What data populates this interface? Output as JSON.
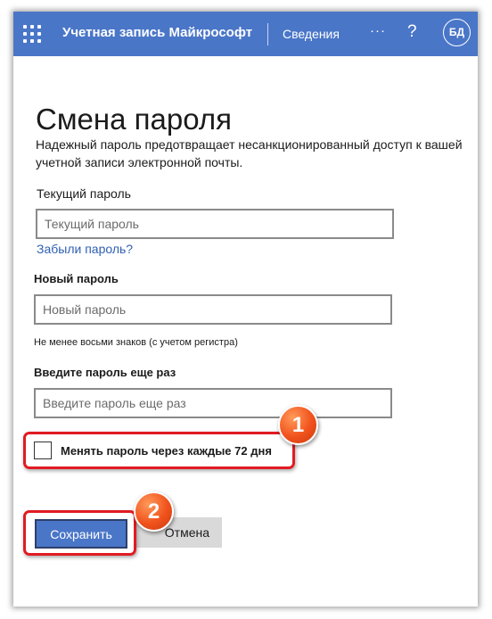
{
  "header": {
    "account_title": "Учетная запись Майкрософт",
    "nav_info": "Сведения",
    "more": "···",
    "help": "?",
    "avatar_initials": "БД",
    "background_color": "#4a76c8"
  },
  "page": {
    "title": "Смена пароля",
    "description": "Надежный пароль предотвращает несанкционированный доступ к вашей учетной записи электронной почты."
  },
  "form": {
    "current_password": {
      "label": "Текущий пароль",
      "placeholder": "Текущий пароль",
      "value": ""
    },
    "forgot_link": "Забыли пароль?",
    "new_password": {
      "label": "Новый пароль",
      "placeholder": "Новый пароль",
      "value": "",
      "hint": "Не менее восьми знаков (с учетом регистра)"
    },
    "confirm_password": {
      "label": "Введите пароль еще раз",
      "placeholder": "Введите пароль еще раз",
      "value": ""
    },
    "expire_checkbox": {
      "label": "Менять пароль через каждые 72 дня",
      "checked": false
    },
    "save_label": "Сохранить",
    "cancel_label": "Отмена"
  },
  "annotations": {
    "marker_1": "1",
    "marker_2": "2",
    "highlight_color": "#e11b22",
    "marker_color": "#f1521c"
  }
}
